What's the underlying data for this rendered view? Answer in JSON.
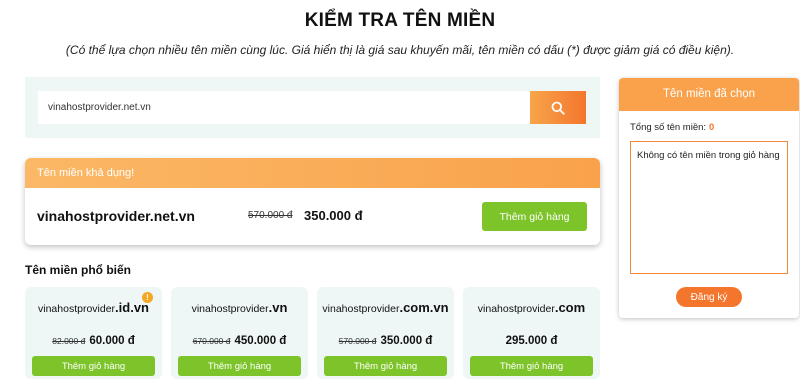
{
  "page": {
    "title": "KIỂM TRA TÊN MIỀN",
    "subtitle": "(Có thể lựa chọn nhiều tên miền cùng lúc. Giá hiển thị là giá sau khuyến mãi, tên miền có dấu (*) được giảm giá có điều kiện)."
  },
  "search": {
    "value": "vinahostprovider.net.vn",
    "button_icon": "search-icon"
  },
  "available": {
    "header": "Tên miền khả dụng!",
    "domain": "vinahostprovider.net.vn",
    "old_price": "570.000 đ",
    "new_price": "350.000 đ",
    "add_label": "Thêm giỏ hàng"
  },
  "popular": {
    "title": "Tên miền phổ biến",
    "items": [
      {
        "name": "vinahostprovider",
        "tld": ".id.vn",
        "old_price": "82.000 đ",
        "new_price": "60.000 đ",
        "add_label": "Thêm giỏ hàng",
        "badge": "!"
      },
      {
        "name": "vinahostprovider",
        "tld": ".vn",
        "old_price": "670.000 đ",
        "new_price": "450.000 đ",
        "add_label": "Thêm giỏ hàng"
      },
      {
        "name": "vinahostprovider",
        "tld": ".com.vn",
        "old_price": "570.000 đ",
        "new_price": "350.000 đ",
        "add_label": "Thêm giỏ hàng"
      },
      {
        "name": "vinahostprovider",
        "tld": ".com",
        "old_price": "",
        "new_price": "295.000 đ",
        "add_label": "Thêm giỏ hàng"
      }
    ]
  },
  "cart": {
    "header": "Tên miền đã chọn",
    "count_label": "Tổng số tên miền:",
    "count": "0",
    "empty_text": "Không có tên miền trong giỏ hàng",
    "register_label": "Đăng ký"
  },
  "colors": {
    "accent_orange": "#f4762d",
    "header_orange": "#f9a24b",
    "green": "#7dc42a",
    "panel_bg": "#eef7f6"
  }
}
